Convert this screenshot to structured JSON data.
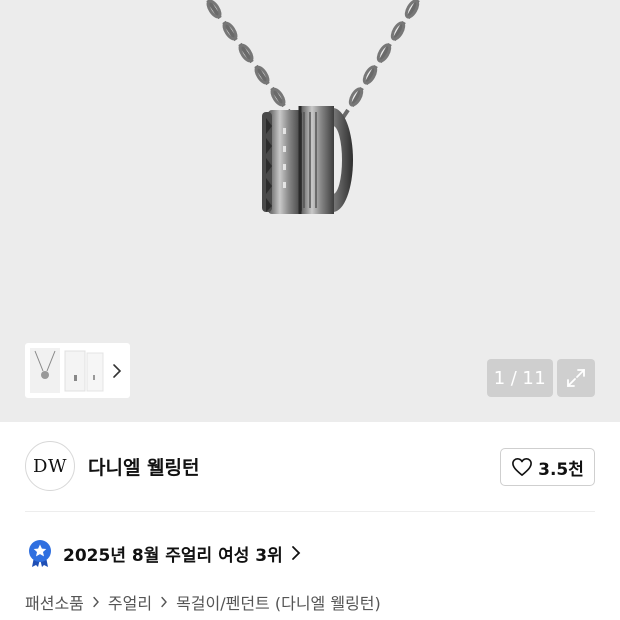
{
  "gallery": {
    "counter_current": "1",
    "counter_separator": "/",
    "counter_total": "11"
  },
  "brand": {
    "logo_text": "DW",
    "name": "다니엘 웰링턴"
  },
  "like": {
    "count": "3.5천"
  },
  "ranking": {
    "text": "2025년 8월 주얼리 여성 3위"
  },
  "breadcrumb": {
    "items": [
      "패션소품",
      "주얼리",
      "목걸이/펜던트 (다니엘 웰링턴)"
    ]
  },
  "colors": {
    "hero_background": "#ececec",
    "overlay_button": "#cfcfcf",
    "badge_blue": "#2f6fe0"
  },
  "icons": {
    "thumb_arrow": "chevron-right-icon",
    "expand": "expand-icon",
    "like": "heart-outline-icon",
    "ranking_badge": "medal-star-icon",
    "ranking_arrow": "chevron-right-icon",
    "breadcrumb_separator": "chevron-right-icon"
  }
}
